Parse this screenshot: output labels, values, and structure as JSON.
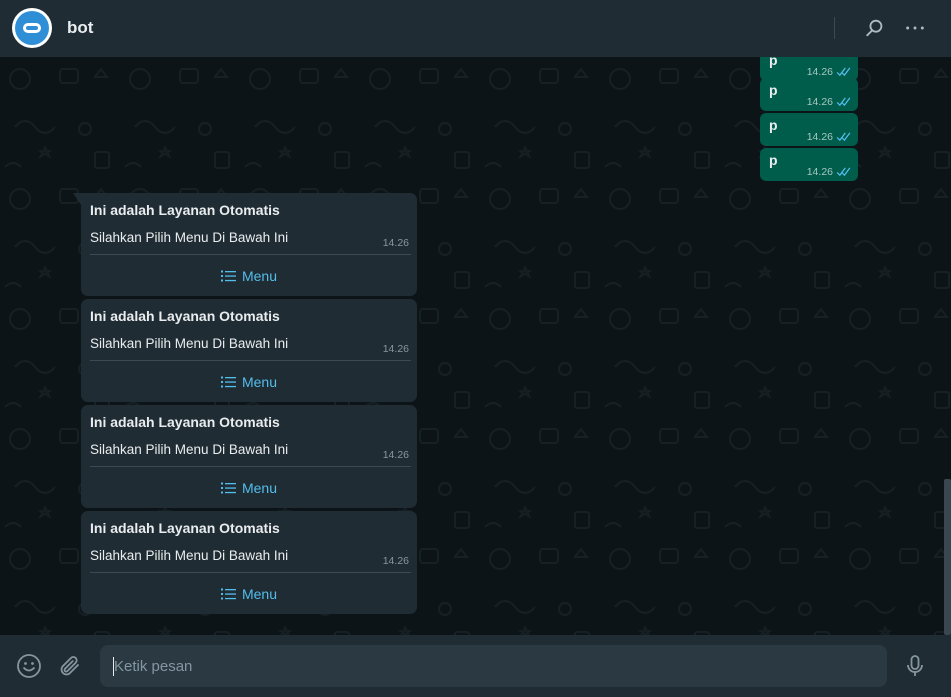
{
  "header": {
    "contact_name": "bot",
    "avatar_icon": "robot-face-icon",
    "search_icon": "search-icon",
    "menu_icon": "more-options-icon"
  },
  "outgoing_messages": [
    {
      "text": "p",
      "time": "14.26",
      "status": "read-double-check"
    },
    {
      "text": "p",
      "time": "14.26",
      "status": "read-double-check"
    },
    {
      "text": "p",
      "time": "14.26",
      "status": "read-double-check"
    },
    {
      "text": "p",
      "time": "14.26",
      "status": "read-double-check"
    }
  ],
  "incoming_messages": [
    {
      "title": "Ini adalah Layanan Otomatis",
      "body": "Silahkan Pilih Menu Di Bawah Ini",
      "time": "14.26",
      "button": "Menu"
    },
    {
      "title": "Ini adalah Layanan Otomatis",
      "body": "Silahkan Pilih Menu Di Bawah Ini",
      "time": "14.26",
      "button": "Menu"
    },
    {
      "title": "Ini adalah Layanan Otomatis",
      "body": "Silahkan Pilih Menu Di Bawah Ini",
      "time": "14.26",
      "button": "Menu"
    },
    {
      "title": "Ini adalah Layanan Otomatis",
      "body": "Silahkan Pilih Menu Di Bawah Ini",
      "time": "14.26",
      "button": "Menu"
    }
  ],
  "composer": {
    "placeholder": "Ketik pesan",
    "emoji_icon": "emoji-icon",
    "attach_icon": "paperclip-icon",
    "mic_icon": "microphone-icon"
  },
  "colors": {
    "header_bg": "#202c33",
    "chat_bg": "#0d1418",
    "outgoing_bubble": "#005c4b",
    "incoming_bubble": "#202c33",
    "link_blue": "#53bdeb"
  }
}
